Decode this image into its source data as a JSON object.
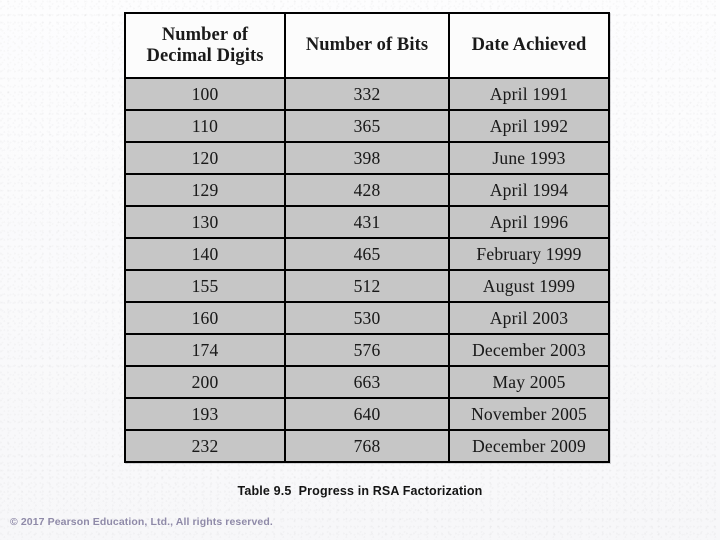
{
  "slide": {
    "caption": "Table 9.5  Progress in RSA Factorization",
    "copyright": "© 2017 Pearson Education, Ltd., All rights reserved.",
    "colors": {
      "page_background": "#fbfbfc",
      "table_border": "#000000",
      "header_cell_background": "#fcfcfc",
      "body_cell_background": "#c6c6c6",
      "body_text": "#1a1a1a",
      "caption_text": "#141414",
      "copyright_text": "#8f8aa8"
    }
  },
  "table": {
    "headers": [
      {
        "line1": "Number of",
        "line2": "Decimal Digits"
      },
      {
        "line1": "Number of Bits",
        "line2": ""
      },
      {
        "line1": "Date Achieved",
        "line2": ""
      }
    ],
    "rows": [
      {
        "digits": "100",
        "bits": "332",
        "date": "April 1991"
      },
      {
        "digits": "110",
        "bits": "365",
        "date": "April 1992"
      },
      {
        "digits": "120",
        "bits": "398",
        "date": "June 1993"
      },
      {
        "digits": "129",
        "bits": "428",
        "date": "April 1994"
      },
      {
        "digits": "130",
        "bits": "431",
        "date": "April 1996"
      },
      {
        "digits": "140",
        "bits": "465",
        "date": "February 1999"
      },
      {
        "digits": "155",
        "bits": "512",
        "date": "August 1999"
      },
      {
        "digits": "160",
        "bits": "530",
        "date": "April 2003"
      },
      {
        "digits": "174",
        "bits": "576",
        "date": "December 2003"
      },
      {
        "digits": "200",
        "bits": "663",
        "date": "May 2005"
      },
      {
        "digits": "193",
        "bits": "640",
        "date": "November 2005"
      },
      {
        "digits": "232",
        "bits": "768",
        "date": "December 2009"
      }
    ]
  }
}
